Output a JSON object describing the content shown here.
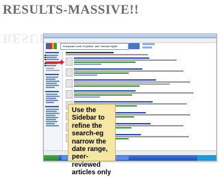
{
  "slide": {
    "title": "RESULTS-MASSIVE!!"
  },
  "browser": {
    "search_query": "\"european court of justice\" and \"human rights\""
  },
  "callout": {
    "text": "Use the Sidebar to refine the search-eg narrow the date range, peer-reviewed articles only"
  }
}
